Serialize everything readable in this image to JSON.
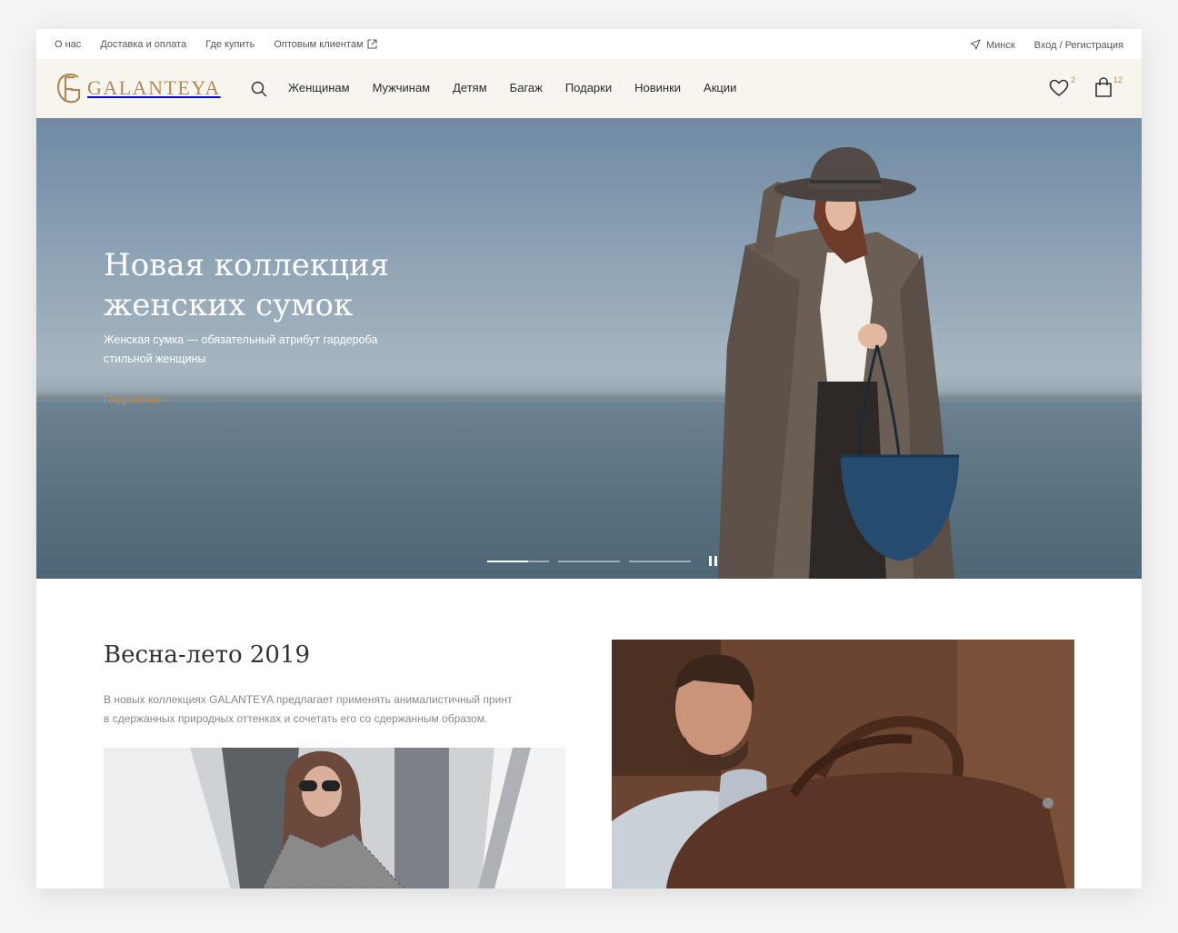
{
  "topbar": {
    "links": [
      "О нас",
      "Доставка и оплата",
      "Где купить",
      "Оптовым клиентам"
    ],
    "city": "Минск",
    "auth": "Вход / Регистрация"
  },
  "header": {
    "logo_text": "GALANTEYA",
    "nav": [
      "Женщинам",
      "Мужчинам",
      "Детям",
      "Багаж",
      "Подарки",
      "Новинки",
      "Акции"
    ],
    "favorites_count": "2",
    "cart_count": "12"
  },
  "hero": {
    "title_line1": "Новая коллекция",
    "title_line2": "женских сумок",
    "subtitle_line1": "Женская  сумка — обязательный атрибут гардероба",
    "subtitle_line2": "стильной женщины",
    "more_link": "Подробнее",
    "slides": 3,
    "active_slide": 1
  },
  "section": {
    "title": "Весна-лето 2019",
    "text_line1": "В новых коллекциях GALANTEYA  предлагает применять анималистичный принт",
    "text_line2": "в сдержанных природных оттенках и сочетать его со сдержанным образом."
  },
  "colors": {
    "accent": "#c88a48",
    "logo": "#b08a55",
    "header_bg": "#f8f5ef"
  }
}
